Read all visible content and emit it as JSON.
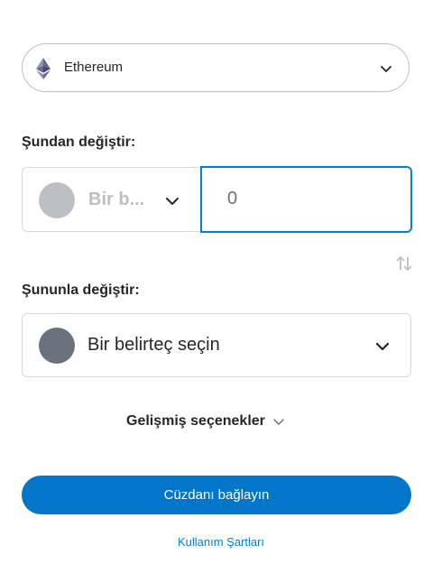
{
  "network": {
    "name": "Ethereum",
    "icon": "ethereum-icon"
  },
  "swap_from": {
    "label": "Şundan değiştir:",
    "token_placeholder": "Bir b...",
    "amount": "0"
  },
  "swap_to": {
    "label": "Şununla değiştir:",
    "token_placeholder": "Bir belirteç seçin"
  },
  "advanced_options": {
    "label": "Gelişmiş seçenekler"
  },
  "actions": {
    "connect_wallet": "Cüzdanı bağlayın",
    "terms": "Kullanım Şartları"
  },
  "colors": {
    "accent": "#037dd6",
    "button": "#0376c9",
    "placeholder_gray": "#bbc0c5",
    "token_dark": "#6a737d"
  }
}
